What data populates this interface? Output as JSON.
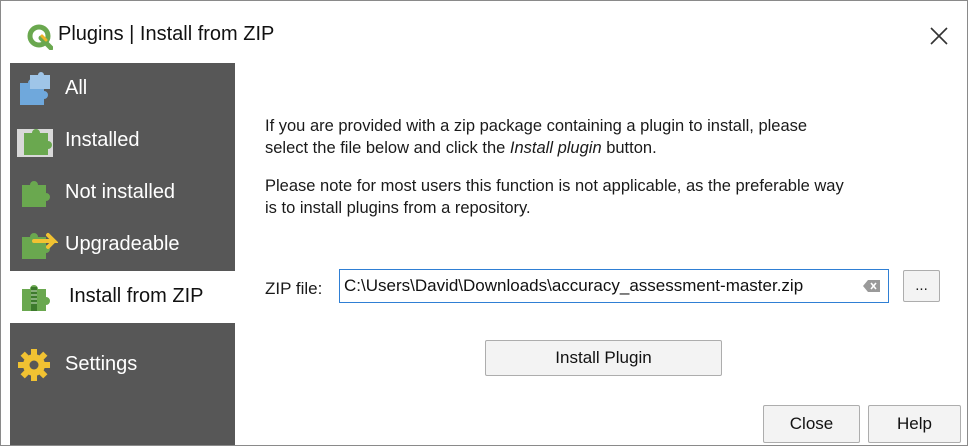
{
  "window": {
    "title": "Plugins | Install from ZIP"
  },
  "sidebar": {
    "items": [
      {
        "label": "All",
        "icon": "puzzle-blue-icon"
      },
      {
        "label": "Installed",
        "icon": "puzzle-installed-icon"
      },
      {
        "label": "Not installed",
        "icon": "puzzle-green-icon"
      },
      {
        "label": "Upgradeable",
        "icon": "puzzle-upgrade-icon"
      },
      {
        "label": "Install from ZIP",
        "icon": "puzzle-zip-icon",
        "selected": true
      },
      {
        "label": "Settings",
        "icon": "gear-icon"
      }
    ]
  },
  "content": {
    "para1_line1": "If you are provided with a zip package containing a plugin to install, please",
    "para1_line2_pre": "select the file below and click the ",
    "para1_line2_em": "Install plugin",
    "para1_line2_post": " button.",
    "para2_line1": "Please note for most users this function is not applicable, as the preferable way",
    "para2_line2": "is to install plugins from a repository.",
    "zip_label": "ZIP file:",
    "zip_value": "C:\\Users\\David\\Downloads\\accuracy_assessment-master.zip",
    "browse_label": "...",
    "install_label": "Install Plugin"
  },
  "footer": {
    "close_label": "Close",
    "help_label": "Help"
  },
  "colors": {
    "sidebar_bg": "#575757",
    "input_border": "#2f7fd4",
    "qgis_green": "#6aa84f"
  }
}
